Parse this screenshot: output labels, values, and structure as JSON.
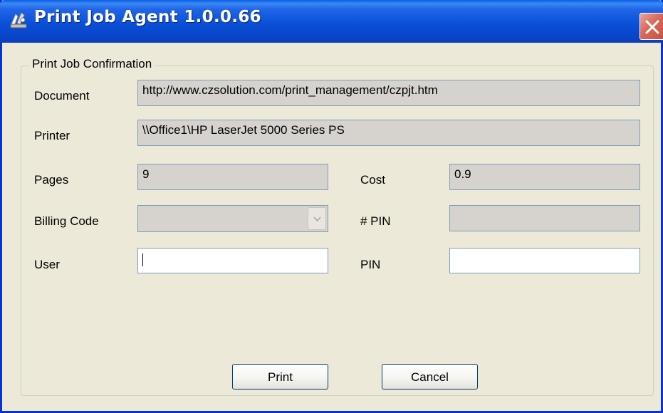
{
  "window": {
    "title": "Print Job Agent 1.0.0.66",
    "app_icon": "printer-agent-icon",
    "close_icon": "close-icon"
  },
  "group": {
    "label": "Print Job Confirmation"
  },
  "form": {
    "document": {
      "label": "Document",
      "value": "http://www.czsolution.com/print_management/czpjt.htm"
    },
    "printer": {
      "label": "Printer",
      "value": "\\\\Office1\\HP LaserJet 5000 Series PS"
    },
    "pages": {
      "label": "Pages",
      "value": "9"
    },
    "cost": {
      "label": "Cost",
      "value": "0.9"
    },
    "billing_code": {
      "label": "Billing Code",
      "value": ""
    },
    "pin_count": {
      "label": "# PIN",
      "value": ""
    },
    "user": {
      "label": "User",
      "value": ""
    },
    "pin": {
      "label": "PIN",
      "value": ""
    }
  },
  "buttons": {
    "print": "Print",
    "cancel": "Cancel"
  },
  "colors": {
    "titlebar": "#0a50d8",
    "window_bg": "#ece9d8",
    "readonly_field": "#d6d3ce",
    "close_button": "#d86a58"
  }
}
